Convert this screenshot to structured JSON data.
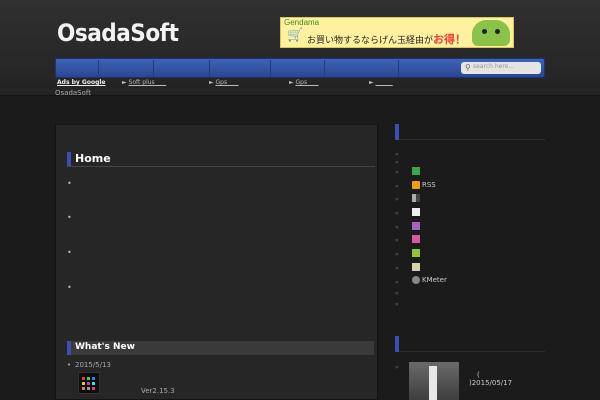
{
  "header": {
    "site_title": "OsadaSoft",
    "banner": {
      "brand": "Gendama",
      "text_main": "お買い物するならげん玉経由が",
      "text_deal": "お得！"
    }
  },
  "nav": {
    "search_placeholder": "search here...",
    "subnav_items": [
      {
        "label": "Ads by Google",
        "prefix": ""
      },
      {
        "label": "Soft plus",
        "prefix": "► "
      },
      {
        "label": "Gps",
        "prefix": "► "
      },
      {
        "label": "Gps",
        "prefix": "► "
      },
      {
        "label": "",
        "prefix": "► "
      }
    ]
  },
  "breadcrumb": "OsadaSoft",
  "main": {
    "heading": "Home",
    "bullet": "•",
    "whats_new": {
      "heading": "What's New",
      "date": "2015/5/13",
      "version": "Ver2.15.3"
    }
  },
  "sidebar": {
    "items": [
      {
        "icon": "app-icon-green",
        "label": ""
      },
      {
        "icon": "rss-icon",
        "label": "RSS"
      },
      {
        "icon": "app-icon-tile",
        "label": ""
      },
      {
        "icon": "app-icon-white",
        "label": ""
      },
      {
        "icon": "app-icon-purple",
        "label": ""
      },
      {
        "icon": "app-icon-pink",
        "label": ""
      },
      {
        "icon": "app-icon-lime",
        "label": ""
      },
      {
        "icon": "app-icon-notebook",
        "label": ""
      },
      {
        "icon": "kmeter-icon",
        "label": "KMeter"
      }
    ],
    "post": {
      "paren": "(",
      "date": ")2015/05/17"
    }
  }
}
